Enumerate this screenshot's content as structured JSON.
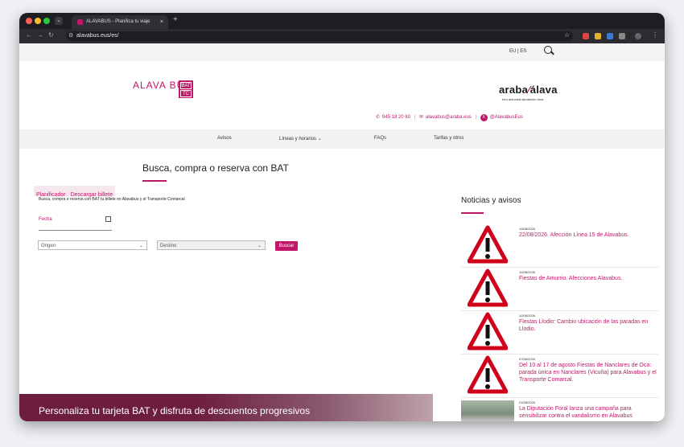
{
  "browser": {
    "tab_title": "ALAVABUS - Planifica tu viaje",
    "tab_close": "×",
    "new_tab": "+",
    "url": "alavabus.eus/es/"
  },
  "header": {
    "lang": "EU | ES",
    "logo_text": "ALAVA BUS",
    "logo_badge_top": "BAT",
    "logo_badge_bottom": "TC",
    "araba_logo_main": "araba",
    "araba_logo_slash": "⁄",
    "araba_logo_second": "álava",
    "araba_logo_sub": "foru aldundia diputación foral",
    "phone": "945 18 20 60",
    "email": "alavabus@araba.eus",
    "social": "@AlavabusEus"
  },
  "menu": {
    "items": [
      "Avisos",
      "Líneas y horarios ⌄",
      "FAQs",
      "Tarifas y otros"
    ]
  },
  "main": {
    "title": "Busca, compra o reserva con BAT",
    "tab_planner": "Planificador",
    "tab_download": "Descargar billete",
    "subtitle": "Busca, compra o reserva con BAT tu billete en Alavabus y el Transporte Comarcal",
    "date_label": "Fecha",
    "origin_placeholder": "Origen",
    "dest_placeholder": "Destino",
    "search_button": "Buscar",
    "banner_text": "Personaliza tu tarjeta BAT y disfruta de descuentos progresivos"
  },
  "news": {
    "heading": "Noticias y avisos",
    "items": [
      {
        "date": "10/08/2026",
        "title": "22/08/2026. Afección Línea 15 de Alavabus."
      },
      {
        "date": "10/08/2026",
        "title": "Fiestas de Amurrio. Afecciones Alavabus."
      },
      {
        "date": "10/08/2026",
        "title": "Fiestas Llodio: Cambio ubicación de las paradas en Llodio."
      },
      {
        "date": "07/08/2026",
        "title": "Del 10 al 17 de agosto Fiestas de Nanclares de Oca: parada única en Nanclares (Vicuña) para Alavabus y el Transporte Comarcal."
      },
      {
        "date": "01/08/2026",
        "title": "La Diputación Foral lanza una campaña para sensibilizar contra el vandalismo en Alavabus"
      }
    ]
  },
  "colors": {
    "accent": "#c01868",
    "banner": "#6d1e3e"
  }
}
